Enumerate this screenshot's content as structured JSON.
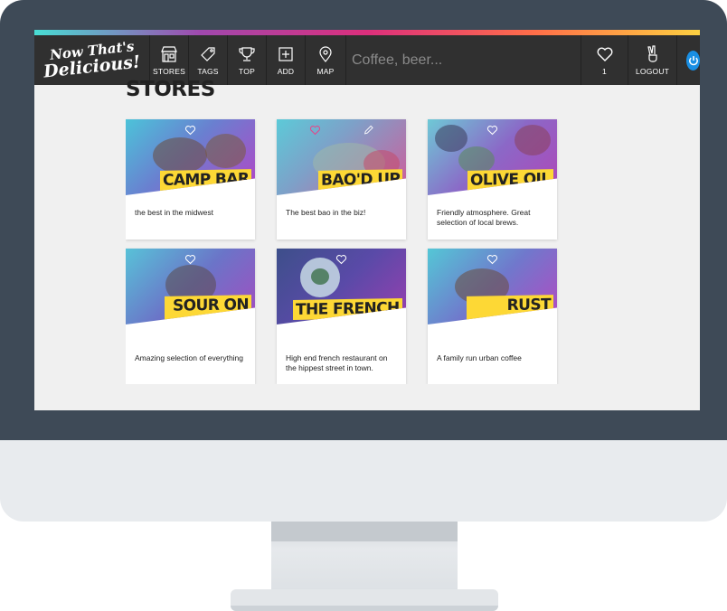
{
  "nav": {
    "logo_line1": "Now That's",
    "logo_line2": "Delicious!",
    "items": [
      {
        "label": "STORES",
        "icon": "store-icon"
      },
      {
        "label": "TAGS",
        "icon": "tag-icon"
      },
      {
        "label": "TOP",
        "icon": "trophy-icon"
      },
      {
        "label": "ADD",
        "icon": "add-icon"
      },
      {
        "label": "MAP",
        "icon": "map-pin-icon"
      }
    ],
    "search_placeholder": "Coffee, beer...",
    "hearts_count": "1",
    "logout_label": "LOGOUT"
  },
  "page": {
    "title": "STORES"
  },
  "stores": [
    {
      "name": "CAMP BAR",
      "description": "the best in the midwest"
    },
    {
      "name": "BAO'D UP",
      "description": "The best bao in the biz!"
    },
    {
      "name": "OLIVE OIL",
      "description": "Friendly atmosphere. Great selection of local brews."
    },
    {
      "name": "SOUR ON KING",
      "description": "Amazing selection of everything"
    },
    {
      "name": "THE FRENCH",
      "description": "High end french restaurant on the hippest street in town."
    },
    {
      "name": "RUST CITY BREWERY",
      "description": "A family run urban coffee"
    }
  ],
  "colors": {
    "bezel": "#3e4a57",
    "navbar": "#303030",
    "name_tag": "#fdd835",
    "accent_blue": "#1a8fe3"
  }
}
